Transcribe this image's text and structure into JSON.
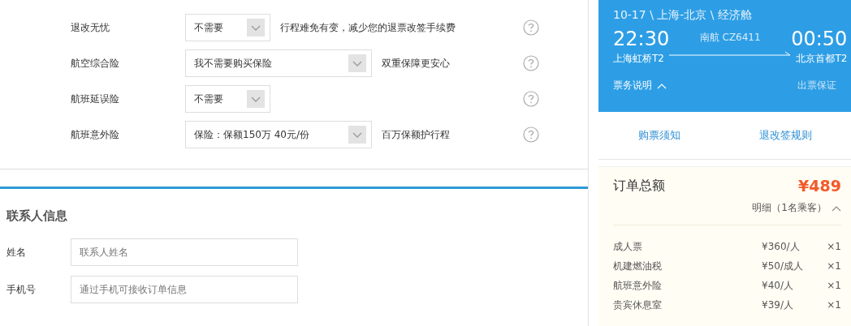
{
  "insurance": [
    {
      "label": "退改无忧",
      "value": "不需要",
      "note": "行程难免有变，减少您的退票改签手续费"
    },
    {
      "label": "航空综合险",
      "value": "我不需要购买保险",
      "note": "双重保障更安心"
    },
    {
      "label": "航班延误险",
      "value": "不需要"
    },
    {
      "label": "航班意外险",
      "value": "保险：保额150万 40元/份",
      "note": "百万保额护行程"
    }
  ],
  "contact": {
    "title": "联系人信息",
    "fields": [
      {
        "label": "姓名",
        "placeholder": "联系人姓名"
      },
      {
        "label": "手机号",
        "placeholder": "通过手机可接收订单信息"
      }
    ]
  },
  "flight": {
    "route": "10-17 \\ 上海-北京 \\ 经济舱",
    "depart_time": "22:30",
    "airline": "南航 CZ6411",
    "arrive_time": "00:50",
    "depart_airport": "上海虹桥T2",
    "arrive_airport": "北京首都T2",
    "ticket_info": "票务说明",
    "ticket_info_expanded": true,
    "guarantee": "出票保证",
    "links": [
      "购票须知",
      "退改签规则"
    ]
  },
  "order": {
    "title": "订单总额",
    "total": "¥489",
    "detail": "明细（1名乘客）",
    "detail_expanded": true,
    "items": [
      {
        "name": "成人票",
        "price": "¥360/人",
        "qty": "×1"
      },
      {
        "name": "机建燃油税",
        "price": "¥50/成人",
        "qty": "×1"
      },
      {
        "name": "航班意外险",
        "price": "¥40/人",
        "qty": "×1"
      },
      {
        "name": "贵宾休息室",
        "price": "¥39/人",
        "qty": "×1"
      }
    ]
  }
}
